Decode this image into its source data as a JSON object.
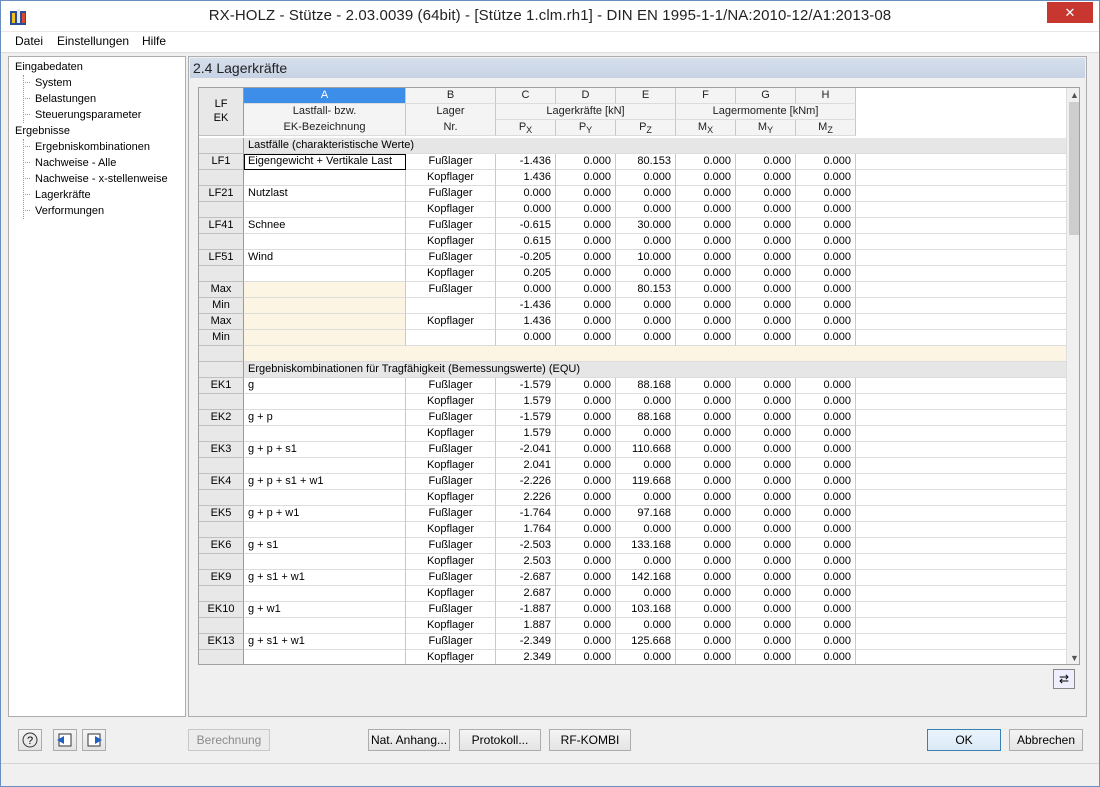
{
  "window": {
    "title": "RX-HOLZ - Stütze - 2.03.0039 (64bit) - [Stütze 1.clm.rh1] - DIN EN 1995-1-1/NA:2010-12/A1:2013-08"
  },
  "menu": [
    "Datei",
    "Einstellungen",
    "Hilfe"
  ],
  "tree": {
    "input_label": "Eingabedaten",
    "input_items": [
      "System",
      "Belastungen",
      "Steuerungsparameter"
    ],
    "results_label": "Ergebnisse",
    "results_items": [
      "Ergebniskombinationen",
      "Nachweise - Alle",
      "Nachweise - x-stellenweise",
      "Lagerkräfte",
      "Verformungen"
    ]
  },
  "section_title": "2.4 Lagerkräfte",
  "table": {
    "col_letters": [
      "A",
      "B",
      "C",
      "D",
      "E",
      "F",
      "G",
      "H"
    ],
    "corner": [
      "LF",
      "EK"
    ],
    "h_a": [
      "Lastfall- bzw.",
      "EK-Bezeichnung"
    ],
    "h_b": [
      "Lager",
      "Nr."
    ],
    "h_forces": "Lagerkräfte [kN]",
    "h_moments": "Lagermomente [kNm]",
    "sub": [
      {
        "b": "P",
        "s": "X"
      },
      {
        "b": "P",
        "s": "Y"
      },
      {
        "b": "P",
        "s": "Z"
      },
      {
        "b": "M",
        "s": "X"
      },
      {
        "b": "M",
        "s": "Y"
      },
      {
        "b": "M",
        "s": "Z"
      }
    ],
    "rows": [
      {
        "kind": "section",
        "text": "Lastfälle (charakteristische Werte)"
      },
      {
        "id": "LF1",
        "name": "Eigengewicht + Vertikale Last",
        "lager": "Fußlager",
        "v": [
          "-1.436",
          "0.000",
          "80.153",
          "0.000",
          "0.000",
          "0.000"
        ],
        "selected": true
      },
      {
        "id": "",
        "name": "",
        "lager": "Kopflager",
        "v": [
          "1.436",
          "0.000",
          "0.000",
          "0.000",
          "0.000",
          "0.000"
        ]
      },
      {
        "id": "LF21",
        "name": "Nutzlast",
        "lager": "Fußlager",
        "v": [
          "0.000",
          "0.000",
          "0.000",
          "0.000",
          "0.000",
          "0.000"
        ]
      },
      {
        "id": "",
        "name": "",
        "lager": "Kopflager",
        "v": [
          "0.000",
          "0.000",
          "0.000",
          "0.000",
          "0.000",
          "0.000"
        ]
      },
      {
        "id": "LF41",
        "name": "Schnee",
        "lager": "Fußlager",
        "v": [
          "-0.615",
          "0.000",
          "30.000",
          "0.000",
          "0.000",
          "0.000"
        ]
      },
      {
        "id": "",
        "name": "",
        "lager": "Kopflager",
        "v": [
          "0.615",
          "0.000",
          "0.000",
          "0.000",
          "0.000",
          "0.000"
        ]
      },
      {
        "id": "LF51",
        "name": "Wind",
        "lager": "Fußlager",
        "v": [
          "-0.205",
          "0.000",
          "10.000",
          "0.000",
          "0.000",
          "0.000"
        ]
      },
      {
        "id": "",
        "name": "",
        "lager": "Kopflager",
        "v": [
          "0.205",
          "0.000",
          "0.000",
          "0.000",
          "0.000",
          "0.000"
        ]
      },
      {
        "id": "Max",
        "name": "",
        "lager": "Fußlager",
        "v": [
          "0.000",
          "0.000",
          "80.153",
          "0.000",
          "0.000",
          "0.000"
        ],
        "cream": true
      },
      {
        "id": "Min",
        "name": "",
        "lager": "",
        "v": [
          "-1.436",
          "0.000",
          "0.000",
          "0.000",
          "0.000",
          "0.000"
        ],
        "cream": true
      },
      {
        "id": "Max",
        "name": "",
        "lager": "Kopflager",
        "v": [
          "1.436",
          "0.000",
          "0.000",
          "0.000",
          "0.000",
          "0.000"
        ],
        "cream": true
      },
      {
        "id": "Min",
        "name": "",
        "lager": "",
        "v": [
          "0.000",
          "0.000",
          "0.000",
          "0.000",
          "0.000",
          "0.000"
        ],
        "cream": true
      },
      {
        "kind": "blank"
      },
      {
        "kind": "section",
        "text": "Ergebniskombinationen für Tragfähigkeit (Bemessungswerte) (EQU)"
      },
      {
        "id": "EK1",
        "name": "g",
        "lager": "Fußlager",
        "v": [
          "-1.579",
          "0.000",
          "88.168",
          "0.000",
          "0.000",
          "0.000"
        ]
      },
      {
        "id": "",
        "name": "",
        "lager": "Kopflager",
        "v": [
          "1.579",
          "0.000",
          "0.000",
          "0.000",
          "0.000",
          "0.000"
        ]
      },
      {
        "id": "EK2",
        "name": "g + p",
        "lager": "Fußlager",
        "v": [
          "-1.579",
          "0.000",
          "88.168",
          "0.000",
          "0.000",
          "0.000"
        ]
      },
      {
        "id": "",
        "name": "",
        "lager": "Kopflager",
        "v": [
          "1.579",
          "0.000",
          "0.000",
          "0.000",
          "0.000",
          "0.000"
        ]
      },
      {
        "id": "EK3",
        "name": "g + p + s1",
        "lager": "Fußlager",
        "v": [
          "-2.041",
          "0.000",
          "110.668",
          "0.000",
          "0.000",
          "0.000"
        ]
      },
      {
        "id": "",
        "name": "",
        "lager": "Kopflager",
        "v": [
          "2.041",
          "0.000",
          "0.000",
          "0.000",
          "0.000",
          "0.000"
        ]
      },
      {
        "id": "EK4",
        "name": "g + p + s1 + w1",
        "lager": "Fußlager",
        "v": [
          "-2.226",
          "0.000",
          "119.668",
          "0.000",
          "0.000",
          "0.000"
        ]
      },
      {
        "id": "",
        "name": "",
        "lager": "Kopflager",
        "v": [
          "2.226",
          "0.000",
          "0.000",
          "0.000",
          "0.000",
          "0.000"
        ]
      },
      {
        "id": "EK5",
        "name": "g + p + w1",
        "lager": "Fußlager",
        "v": [
          "-1.764",
          "0.000",
          "97.168",
          "0.000",
          "0.000",
          "0.000"
        ]
      },
      {
        "id": "",
        "name": "",
        "lager": "Kopflager",
        "v": [
          "1.764",
          "0.000",
          "0.000",
          "0.000",
          "0.000",
          "0.000"
        ]
      },
      {
        "id": "EK6",
        "name": "g + s1",
        "lager": "Fußlager",
        "v": [
          "-2.503",
          "0.000",
          "133.168",
          "0.000",
          "0.000",
          "0.000"
        ]
      },
      {
        "id": "",
        "name": "",
        "lager": "Kopflager",
        "v": [
          "2.503",
          "0.000",
          "0.000",
          "0.000",
          "0.000",
          "0.000"
        ]
      },
      {
        "id": "EK9",
        "name": "g + s1 + w1",
        "lager": "Fußlager",
        "v": [
          "-2.687",
          "0.000",
          "142.168",
          "0.000",
          "0.000",
          "0.000"
        ]
      },
      {
        "id": "",
        "name": "",
        "lager": "Kopflager",
        "v": [
          "2.687",
          "0.000",
          "0.000",
          "0.000",
          "0.000",
          "0.000"
        ]
      },
      {
        "id": "EK10",
        "name": "g + w1",
        "lager": "Fußlager",
        "v": [
          "-1.887",
          "0.000",
          "103.168",
          "0.000",
          "0.000",
          "0.000"
        ]
      },
      {
        "id": "",
        "name": "",
        "lager": "Kopflager",
        "v": [
          "1.887",
          "0.000",
          "0.000",
          "0.000",
          "0.000",
          "0.000"
        ]
      },
      {
        "id": "EK13",
        "name": "g + s1 + w1",
        "lager": "Fußlager",
        "v": [
          "-2.349",
          "0.000",
          "125.668",
          "0.000",
          "0.000",
          "0.000"
        ]
      },
      {
        "id": "",
        "name": "",
        "lager": "Kopflager",
        "v": [
          "2.349",
          "0.000",
          "0.000",
          "0.000",
          "0.000",
          "0.000"
        ]
      }
    ]
  },
  "buttons": {
    "calc": "Berechnung",
    "annex": "Nat. Anhang...",
    "protocol": "Protokoll...",
    "rfkombi": "RF-KOMBI",
    "ok": "OK",
    "cancel": "Abbrechen"
  },
  "icons": {
    "help": "help-icon",
    "prev": "previous-page-icon",
    "next": "next-page-icon",
    "export": "export-icon",
    "close": "close-icon"
  },
  "colors": {
    "selected_tab": "#3c8ee8",
    "cream": "#fcf5e3",
    "section": "#e6e6e6"
  }
}
